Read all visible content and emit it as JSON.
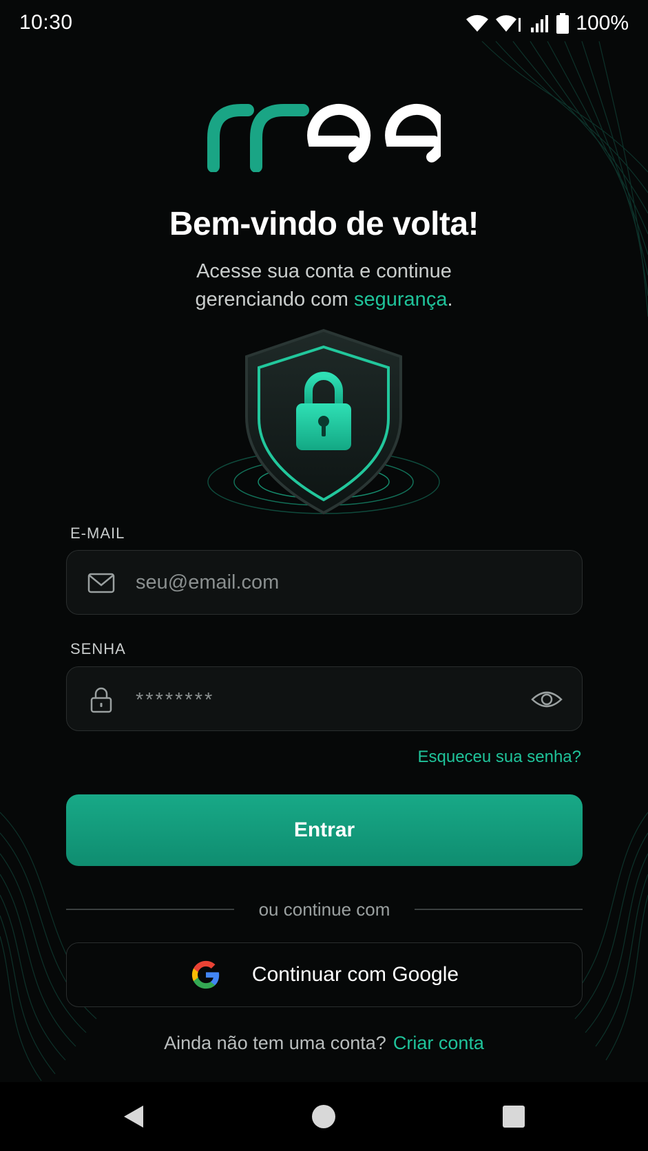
{
  "status_bar": {
    "time": "10:30",
    "battery": "100%"
  },
  "logo": {
    "text": "rree",
    "colors": {
      "primary": "#1aa585",
      "secondary": "#ffffff"
    }
  },
  "header": {
    "title": "Bem-vindo de volta!",
    "subtitle_line1": "Acesse sua conta e continue",
    "subtitle_line2_prefix": "gerenciando com ",
    "subtitle_accent": "segurança",
    "subtitle_suffix": "."
  },
  "hero": {
    "icon": "shield-lock-icon"
  },
  "form": {
    "email_label": "E-MAIL",
    "email_placeholder": "seu@email.com",
    "password_label": "SENHA",
    "password_value": "********",
    "forgot_password": "Esqueceu sua senha?",
    "submit_label": "Entrar"
  },
  "social": {
    "divider_text": "ou continue com",
    "google_label": "Continuar com Google"
  },
  "footer": {
    "prompt": "Ainda não tem uma conta?",
    "signup_link": "Criar conta"
  },
  "theme": {
    "accent": "#1fc39a",
    "background": "#060808",
    "button": "#14a07f"
  },
  "navigation": {
    "icons": [
      "back-icon",
      "home-icon",
      "recents-icon"
    ]
  }
}
